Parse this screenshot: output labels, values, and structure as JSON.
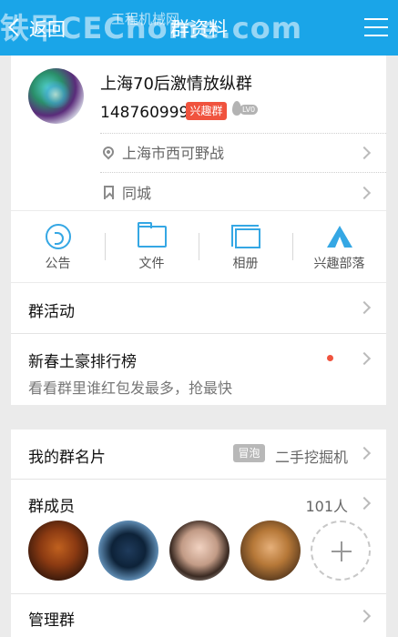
{
  "header": {
    "back_label": "返回",
    "title": "群资料",
    "watermark": "铁甲CEChome.com",
    "watermark_small": "工程机械网"
  },
  "group": {
    "name": "上海70后激情放纵群",
    "id": "148760999",
    "tag": "兴趣群",
    "level": "LV0",
    "location": "上海市西可野战",
    "type": "同城"
  },
  "actions": [
    {
      "label": "公告",
      "icon": "notice-icon"
    },
    {
      "label": "文件",
      "icon": "folder-icon"
    },
    {
      "label": "相册",
      "icon": "album-icon"
    },
    {
      "label": "兴趣部落",
      "icon": "tribe-icon"
    }
  ],
  "rows": {
    "activity": "群活动",
    "ranking_title": "新春土豪排行榜",
    "ranking_sub": "看看群里谁红包发最多，抢最快",
    "card_label": "我的群名片",
    "card_badge": "冒泡",
    "card_value": "二手挖掘机",
    "members_label": "群成员",
    "members_count": "101人",
    "manage": "管理群"
  },
  "colors": {
    "header": "#1aa5e8",
    "accent": "#35a7e4",
    "tag": "#f0533e"
  }
}
